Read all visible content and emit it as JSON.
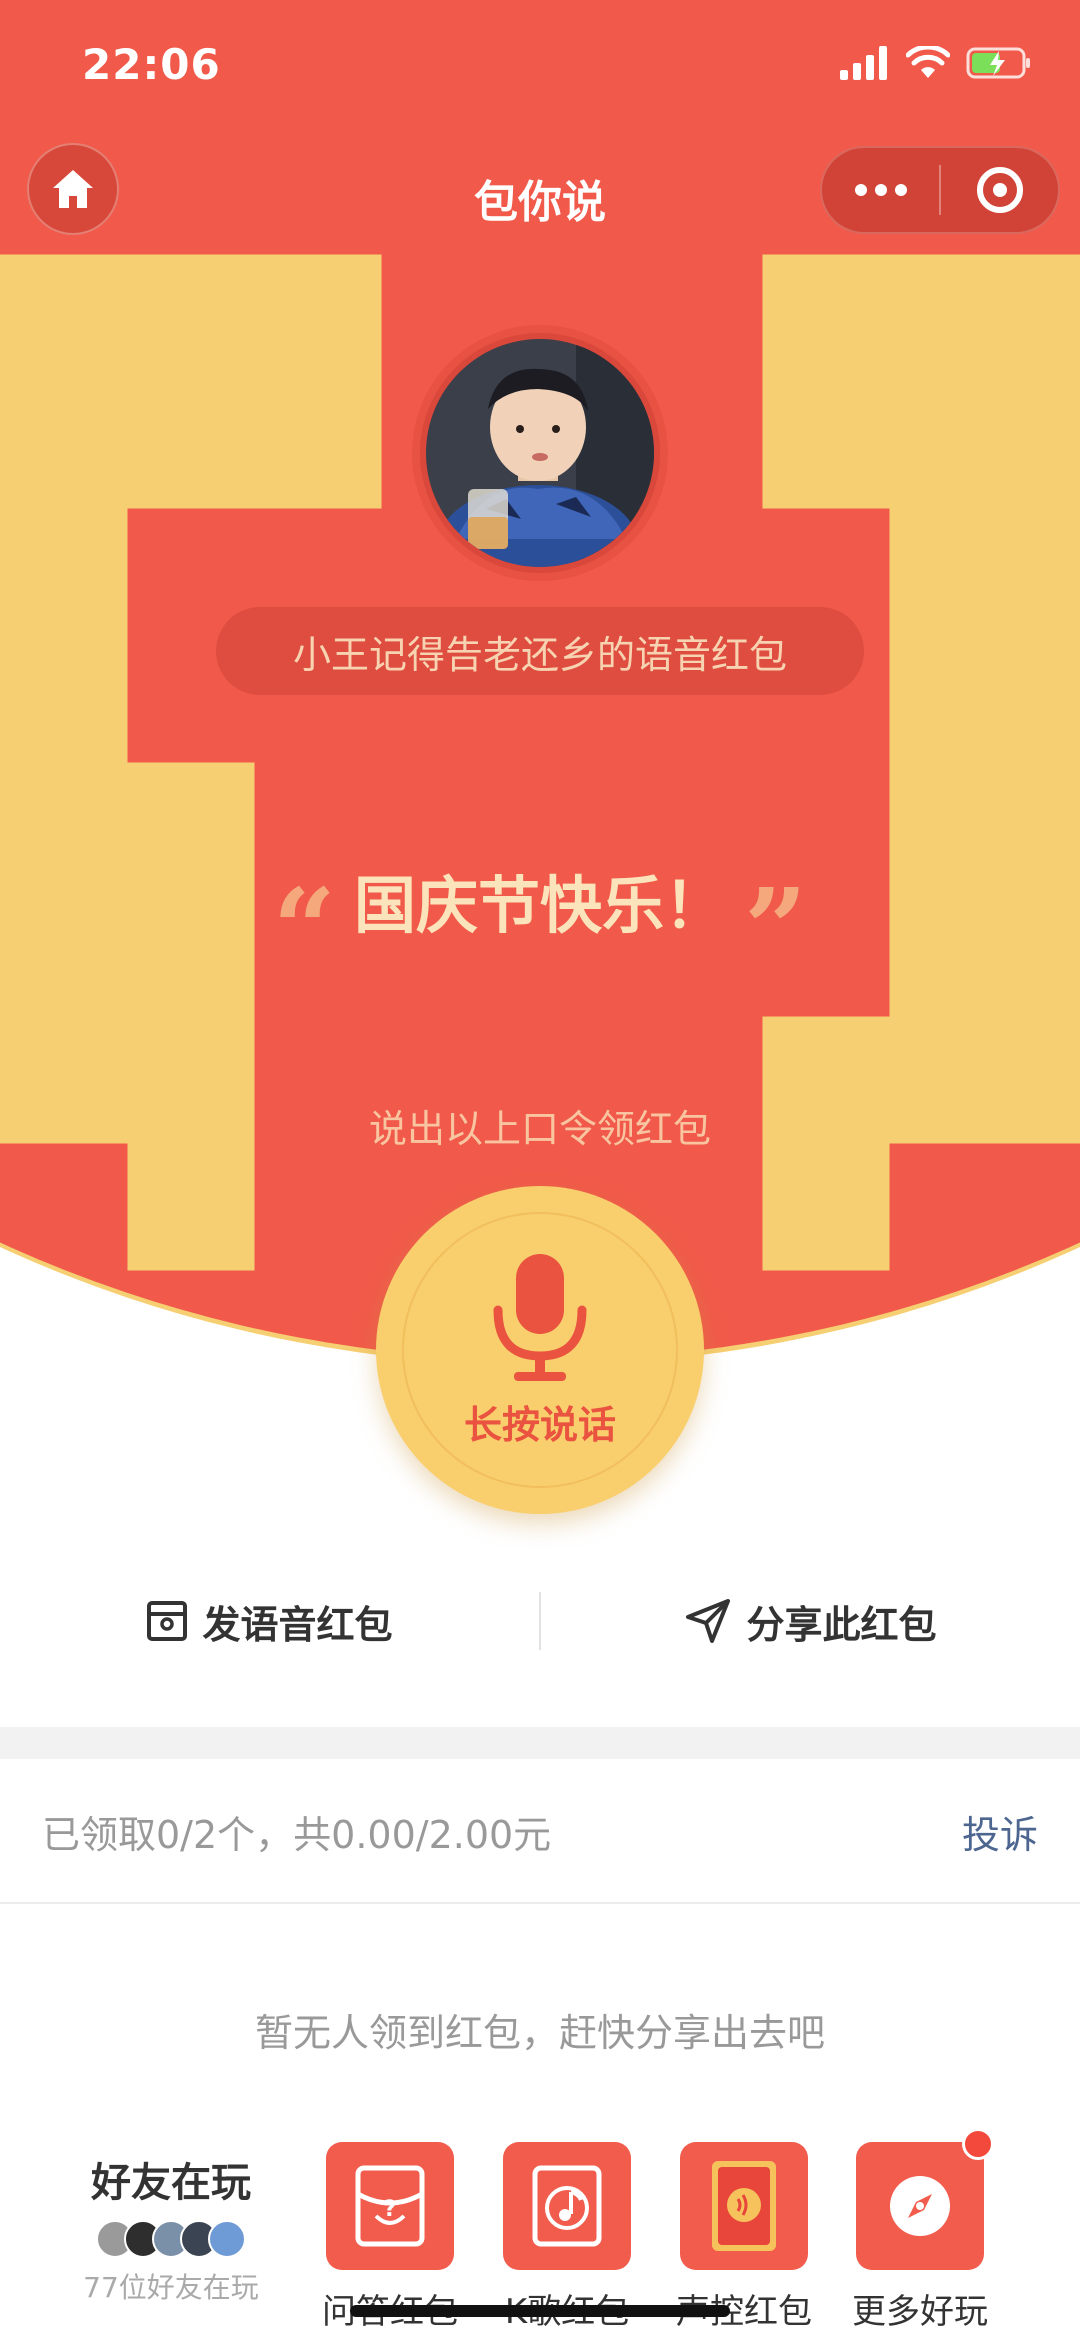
{
  "status_bar": {
    "time": "22:06"
  },
  "nav": {
    "title": "包你说"
  },
  "sender": {
    "name_line": "小王记得告老还乡的语音红包"
  },
  "password": {
    "open_quote": "“",
    "text": "国庆节快乐！",
    "close_quote": "”"
  },
  "hint": "说出以上口令领红包",
  "mic": {
    "label": "长按说话"
  },
  "actions": {
    "send_voice": "发语音红包",
    "share": "分享此红包"
  },
  "stats": {
    "claimed": "已领取0/2个，共0.00/2.00元",
    "complain": "投诉"
  },
  "empty_message": "暂无人领到红包，赶快分享出去吧",
  "friends": {
    "title": "好友在玩",
    "count_text": "77位好友在玩"
  },
  "games": [
    {
      "label": "问答红包",
      "icon": "question-envelope-icon"
    },
    {
      "label": "K歌红包",
      "icon": "music-note-icon"
    },
    {
      "label": "声控红包",
      "icon": "voice-envelope-icon"
    },
    {
      "label": "更多好玩",
      "icon": "compass-icon"
    }
  ],
  "colors": {
    "primary_red": "#f15a4a",
    "gold": "#f9cf6e",
    "link_blue": "#4d6690"
  }
}
